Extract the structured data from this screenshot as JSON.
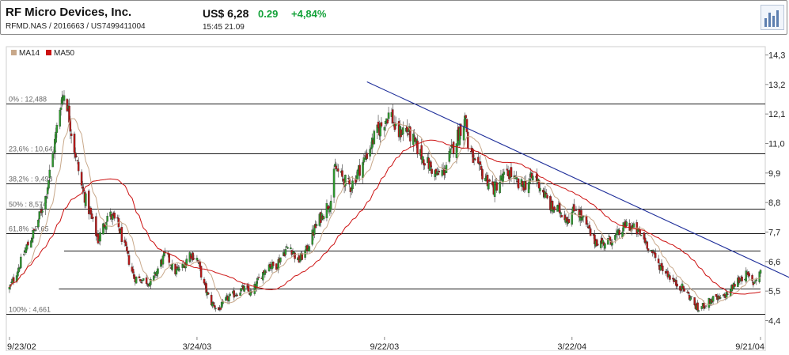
{
  "header": {
    "company": "RF Micro Devices, Inc.",
    "identifiers": "RFMD.NAS  /  2016663  /  US7499411004",
    "price": "US$ 6,28",
    "change": "0.29",
    "change_pct": "+4,84%",
    "time_date": "15:45  21.09",
    "icon": "bar-chart-icon"
  },
  "colors": {
    "ma14": "#c8a88a",
    "ma50": "#cc1111",
    "up": "#2e9a2e",
    "down": "#b81818",
    "trendline": "#1f2f9a",
    "level_line": "#1a1a1a"
  },
  "chart_data": {
    "type": "candlestick",
    "legend": [
      "MA14",
      "MA50"
    ],
    "y_ticks": [
      "14,3",
      "13,2",
      "12,1",
      "11,0",
      "9,9",
      "8,8",
      "7,7",
      "6,6",
      "5,5",
      "4,4"
    ],
    "y_range": [
      4.4,
      14.3
    ],
    "x_ticks": [
      "9/23/02",
      "3/24/03",
      "9/22/03",
      "3/22/04",
      "9/21/04"
    ],
    "fib_levels": [
      {
        "label": "0% : 12,488",
        "value": 12.488
      },
      {
        "label": "23,6% : 10,641",
        "value": 10.641
      },
      {
        "label": "38,2% : 9,498",
        "value": 9.498
      },
      {
        "label": "50% : 8,574",
        "value": 8.574
      },
      {
        "label": "61,8% : 7,65",
        "value": 7.65
      },
      {
        "label": "100% : 4,661",
        "value": 4.661
      }
    ],
    "extra_levels": [
      {
        "value": 7.0,
        "x_start": "2002-11-15",
        "x_end": "2004-09-21"
      },
      {
        "value": 5.6,
        "x_start": "2002-11-10",
        "x_end": "2004-09-21"
      }
    ],
    "trendline": {
      "start": {
        "date": "2003-09-05",
        "value": 13.3
      },
      "end": {
        "date": "2004-09-24",
        "value": 6.4
      }
    },
    "close_anchors": [
      [
        "2002-09-23",
        5.6
      ],
      [
        "2002-10-01",
        6.3
      ],
      [
        "2002-10-08",
        7.0
      ],
      [
        "2002-10-18",
        7.8
      ],
      [
        "2002-10-28",
        9.0
      ],
      [
        "2002-11-05",
        10.8
      ],
      [
        "2002-11-12",
        12.6
      ],
      [
        "2002-11-16",
        13.0
      ],
      [
        "2002-11-23",
        11.2
      ],
      [
        "2002-12-02",
        9.4
      ],
      [
        "2002-12-10",
        8.4
      ],
      [
        "2002-12-18",
        7.4
      ],
      [
        "2002-12-28",
        8.4
      ],
      [
        "2003-01-06",
        8.0
      ],
      [
        "2003-01-14",
        7.0
      ],
      [
        "2003-01-22",
        6.0
      ],
      [
        "2003-02-01",
        5.9
      ],
      [
        "2003-02-08",
        5.8
      ],
      [
        "2003-02-16",
        6.5
      ],
      [
        "2003-02-22",
        6.9
      ],
      [
        "2003-03-02",
        6.2
      ],
      [
        "2003-03-10",
        6.4
      ],
      [
        "2003-03-17",
        6.9
      ],
      [
        "2003-03-24",
        6.7
      ],
      [
        "2003-03-31",
        5.7
      ],
      [
        "2003-04-06",
        5.1
      ],
      [
        "2003-04-14",
        4.8
      ],
      [
        "2003-04-22",
        5.2
      ],
      [
        "2003-04-30",
        5.4
      ],
      [
        "2003-05-08",
        5.6
      ],
      [
        "2003-05-16",
        5.4
      ],
      [
        "2003-05-24",
        6.0
      ],
      [
        "2003-06-01",
        6.5
      ],
      [
        "2003-06-08",
        6.4
      ],
      [
        "2003-06-15",
        6.9
      ],
      [
        "2003-06-22",
        7.2
      ],
      [
        "2003-06-30",
        6.6
      ],
      [
        "2003-07-08",
        7.0
      ],
      [
        "2003-07-16",
        7.8
      ],
      [
        "2003-07-24",
        8.4
      ],
      [
        "2003-08-01",
        8.9
      ],
      [
        "2003-08-05",
        10.1
      ],
      [
        "2003-08-12",
        9.7
      ],
      [
        "2003-08-20",
        9.4
      ],
      [
        "2003-08-28",
        10.0
      ],
      [
        "2003-09-05",
        10.6
      ],
      [
        "2003-09-13",
        11.3
      ],
      [
        "2003-09-21",
        11.8
      ],
      [
        "2003-09-28",
        12.2
      ],
      [
        "2003-10-04",
        11.3
      ],
      [
        "2003-10-12",
        11.6
      ],
      [
        "2003-10-20",
        11.1
      ],
      [
        "2003-10-27",
        10.6
      ],
      [
        "2003-11-04",
        10.2
      ],
      [
        "2003-11-12",
        9.8
      ],
      [
        "2003-11-19",
        10.0
      ],
      [
        "2003-11-26",
        10.7
      ],
      [
        "2003-12-03",
        11.4
      ],
      [
        "2003-12-10",
        12.0
      ],
      [
        "2003-12-12",
        10.9
      ],
      [
        "2003-12-20",
        10.1
      ],
      [
        "2003-12-28",
        9.8
      ],
      [
        "2004-01-06",
        9.3
      ],
      [
        "2004-01-14",
        9.7
      ],
      [
        "2004-01-22",
        9.9
      ],
      [
        "2004-01-30",
        9.4
      ],
      [
        "2004-02-07",
        9.5
      ],
      [
        "2004-02-15",
        9.8
      ],
      [
        "2004-02-23",
        9.2
      ],
      [
        "2004-03-02",
        8.6
      ],
      [
        "2004-03-10",
        8.5
      ],
      [
        "2004-03-18",
        8.2
      ],
      [
        "2004-03-26",
        8.6
      ],
      [
        "2004-04-04",
        8.0
      ],
      [
        "2004-04-12",
        7.4
      ],
      [
        "2004-04-20",
        7.3
      ],
      [
        "2004-04-28",
        7.4
      ],
      [
        "2004-05-06",
        7.6
      ],
      [
        "2004-05-14",
        8.0
      ],
      [
        "2004-05-22",
        7.8
      ],
      [
        "2004-05-30",
        7.5
      ],
      [
        "2004-06-07",
        7.0
      ],
      [
        "2004-06-14",
        6.5
      ],
      [
        "2004-06-22",
        6.2
      ],
      [
        "2004-06-30",
        5.8
      ],
      [
        "2004-07-08",
        5.6
      ],
      [
        "2004-07-16",
        5.2
      ],
      [
        "2004-07-22",
        4.8
      ],
      [
        "2004-07-29",
        5.0
      ],
      [
        "2004-08-06",
        5.2
      ],
      [
        "2004-08-14",
        5.2
      ],
      [
        "2004-08-22",
        5.5
      ],
      [
        "2004-08-30",
        5.9
      ],
      [
        "2004-09-07",
        6.1
      ],
      [
        "2004-09-14",
        5.8
      ],
      [
        "2004-09-21",
        6.28
      ]
    ]
  }
}
